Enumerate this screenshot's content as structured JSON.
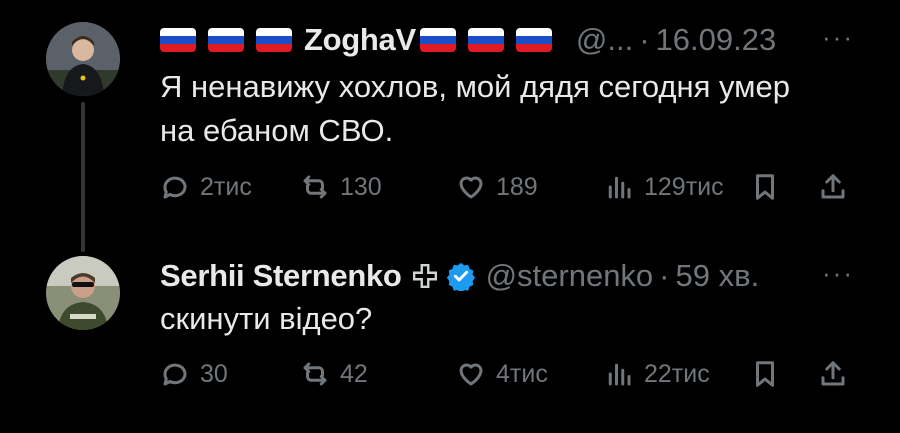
{
  "tweets": [
    {
      "display_name": "ZoghaV",
      "handle": "@...",
      "separator": "·",
      "time": "16.09.23",
      "more_label": "···",
      "text_lines": [
        "Я ненавижу хохлов, мой дядя сегодня умер",
        "на ебаном СВО."
      ],
      "stats": {
        "replies": "2тис",
        "reposts": "130",
        "likes": "189",
        "views": "129тис"
      },
      "avatar_icon": "user-avatar-photo",
      "flag_icon": "russian-flag-icon"
    },
    {
      "display_name": "Serhii Sternenko",
      "handle": "@sternenko",
      "separator": "·",
      "time": "59 хв.",
      "more_label": "···",
      "text_lines": [
        "скинути відео?"
      ],
      "stats": {
        "replies": "30",
        "reposts": "42",
        "likes": "4тис",
        "views": "22тис"
      },
      "avatar_icon": "user-avatar-photo",
      "verified_color": "#1d9bf0"
    }
  ],
  "colors": {
    "background": "#000000",
    "text": "#e7e9ea",
    "muted": "#71767b",
    "thread_line": "#333639"
  }
}
